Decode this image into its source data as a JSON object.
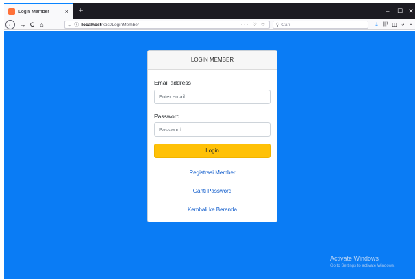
{
  "browser": {
    "tab_title": "Login Member",
    "tab_close": "×",
    "new_tab": "+",
    "window_controls": {
      "minimize": "–",
      "maximize": "☐",
      "close": "✕"
    },
    "nav": {
      "back": "←",
      "forward": "→",
      "reload": "C",
      "home": "⌂"
    },
    "url_host": "localhost",
    "url_path": "/kost/LoginMember",
    "url_actions": "··· ♡ ☆",
    "search_placeholder": "Cari",
    "search_icon": "⚲",
    "toolbar": {
      "download": "⤓",
      "library": "|||\\",
      "sidebar": "◫",
      "addon": "◕",
      "menu": "≡"
    }
  },
  "login": {
    "header": "LOGIN MEMBER",
    "email_label": "Email address",
    "email_placeholder": "Enter email",
    "password_label": "Password",
    "password_placeholder": "Password",
    "login_button": "Login",
    "links": [
      "Registrasi Member",
      "Ganti Password",
      "Kembali ke Beranda"
    ]
  },
  "watermark": {
    "title": "Activate Windows",
    "subtitle": "Go to Settings to activate Windows."
  },
  "colors": {
    "page_background": "#0a7cf5",
    "login_button": "#ffc107",
    "link": "#0a58ca"
  }
}
